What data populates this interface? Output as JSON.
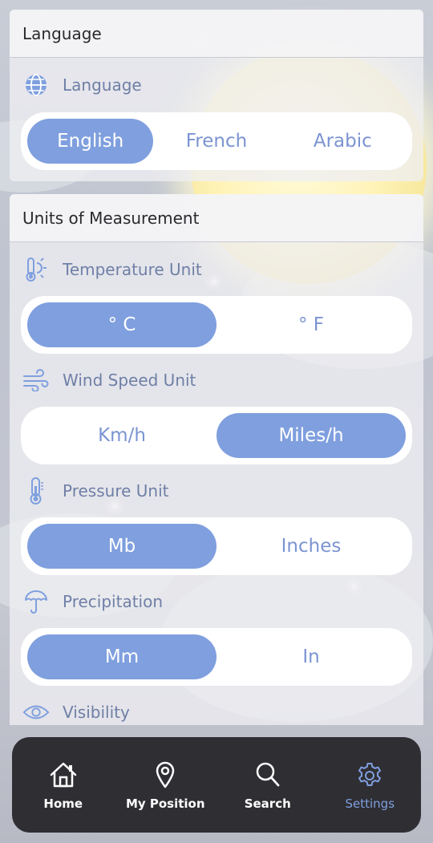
{
  "language_section": {
    "header": "Language",
    "row_label": "Language",
    "row_icon": "globe-icon",
    "options": [
      "English",
      "French",
      "Arabic"
    ],
    "selected": "English"
  },
  "units_section": {
    "header": "Units of Measurement",
    "temperature": {
      "label": "Temperature Unit",
      "icon": "thermometer-sun-icon",
      "options": [
        "° C",
        "° F"
      ],
      "selected": "° C"
    },
    "wind": {
      "label": "Wind Speed Unit",
      "icon": "wind-icon",
      "options": [
        "Km/h",
        "Miles/h"
      ],
      "selected": "Miles/h"
    },
    "pressure": {
      "label": "Pressure Unit",
      "icon": "thermometer-icon",
      "options": [
        "Mb",
        "Inches"
      ],
      "selected": "Mb"
    },
    "precipitation": {
      "label": "Precipitation",
      "icon": "umbrella-icon",
      "options": [
        "Mm",
        "In"
      ],
      "selected": "Mm"
    },
    "visibility": {
      "label": "Visibility",
      "icon": "eye-icon"
    }
  },
  "nav": {
    "items": [
      {
        "label": "Home",
        "icon": "home-icon"
      },
      {
        "label": "My Position",
        "icon": "location-pin-icon"
      },
      {
        "label": "Search",
        "icon": "search-icon"
      },
      {
        "label": "Settings",
        "icon": "gear-icon"
      }
    ],
    "active": "Settings"
  },
  "colors": {
    "accent": "#7f9fde",
    "label": "#6f7fa6",
    "nav_bg": "#2f2e33"
  }
}
